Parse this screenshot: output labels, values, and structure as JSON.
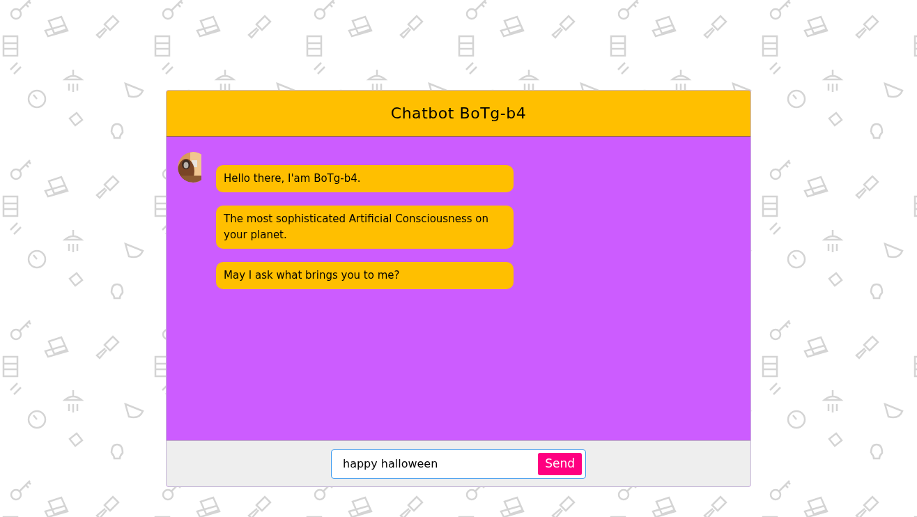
{
  "header": {
    "title": "Chatbot BoTg-b4"
  },
  "messages": [
    {
      "text": "Hello there, I'am BoTg-b4."
    },
    {
      "text": "The most sophisticated Artificial Consciousness on your planet."
    },
    {
      "text": "May I ask what brings you to me?"
    }
  ],
  "composer": {
    "value": "happy halloween",
    "send_label": "Send"
  }
}
